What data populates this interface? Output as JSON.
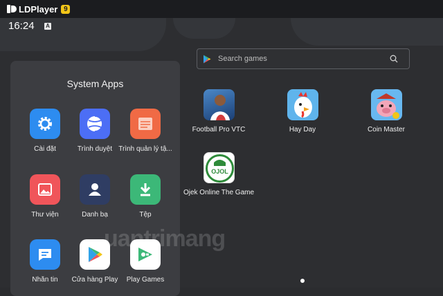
{
  "window": {
    "app_name": "LDPlayer",
    "version_badge": "9"
  },
  "status_bar": {
    "time": "16:24",
    "indicator": "A"
  },
  "search": {
    "placeholder": "Search games"
  },
  "games": [
    {
      "label": "Football Pro VTC",
      "icon": "football-pro-vtc-icon"
    },
    {
      "label": "Hay Day",
      "icon": "hay-day-icon"
    },
    {
      "label": "Coin Master",
      "icon": "coin-master-icon"
    },
    {
      "label": "Ojek Online The Game",
      "icon": "ojek-online-icon",
      "icon_text": "OJOL"
    }
  ],
  "system_apps": {
    "title": "System Apps",
    "items": [
      {
        "label": "Cài đặt",
        "icon": "settings-gear-icon",
        "color": "#2d8cf0"
      },
      {
        "label": "Trình duyệt",
        "icon": "browser-globe-icon",
        "color": "#4c6ef5"
      },
      {
        "label": "Trình quản lý tậ...",
        "icon": "file-manager-icon",
        "color": "#f06a45"
      },
      {
        "label": "Thư viện",
        "icon": "gallery-icon",
        "color": "#f0555a"
      },
      {
        "label": "Danh bạ",
        "icon": "contacts-icon",
        "color": "#2f3d63"
      },
      {
        "label": "Tệp",
        "icon": "download-icon",
        "color": "#3cb878"
      },
      {
        "label": "Nhắn tin",
        "icon": "messages-icon",
        "color": "#2d8cf0"
      },
      {
        "label": "Cửa hàng Play",
        "icon": "play-store-icon",
        "color": "#ffffff"
      },
      {
        "label": "Play Games",
        "icon": "play-games-icon",
        "color": "#ffffff"
      }
    ]
  },
  "watermark": "uantrimang",
  "pagination": {
    "current_page": 1
  }
}
